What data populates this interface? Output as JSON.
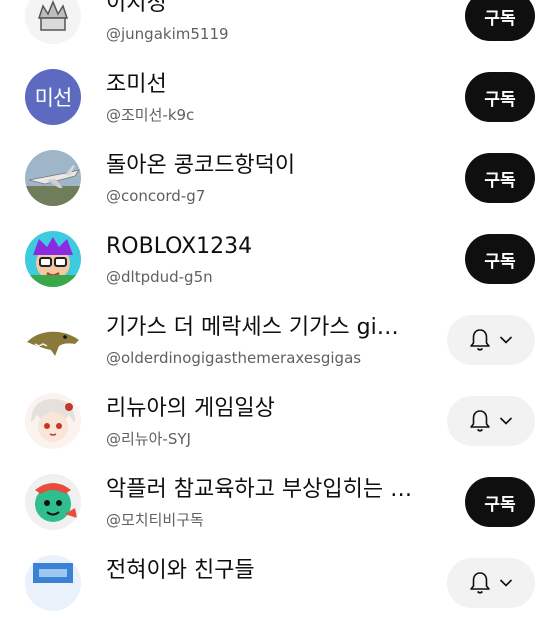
{
  "subscribe_label": "구독",
  "channels": [
    {
      "name": "이지정",
      "handle": "@jungakim5119",
      "action": "subscribe",
      "avatar_icon": "emblem-avatar"
    },
    {
      "name": "조미선",
      "handle": "@조미선-k9c",
      "action": "subscribe",
      "avatar_icon": "text-avatar",
      "avatar_text": "미선",
      "avatar_color": "#5c6bc0"
    },
    {
      "name": "돌아온 콩코드항덕이",
      "handle": "@concord-g7",
      "action": "subscribe",
      "avatar_icon": "airplane-avatar"
    },
    {
      "name": "ROBLOX1234",
      "handle": "@dltpdud-g5n",
      "action": "subscribe",
      "avatar_icon": "cartoon-character-avatar"
    },
    {
      "name": "기가스 더 메락세스 기가스 gi…",
      "handle": "@olderdinogigasthemeraxesgigas",
      "action": "notify",
      "avatar_icon": "dinosaur-avatar"
    },
    {
      "name": "리뉴아의 게임일상",
      "handle": "@리뉴아-SYJ",
      "action": "notify",
      "avatar_icon": "anime-character-avatar"
    },
    {
      "name": "악플러 참교육하고 부상입히는 …",
      "handle": "@모치티비구독",
      "action": "subscribe",
      "avatar_icon": "green-character-avatar"
    },
    {
      "name": "전혀이와 친구들",
      "handle": "",
      "action": "notify",
      "avatar_icon": "blue-avatar"
    }
  ]
}
